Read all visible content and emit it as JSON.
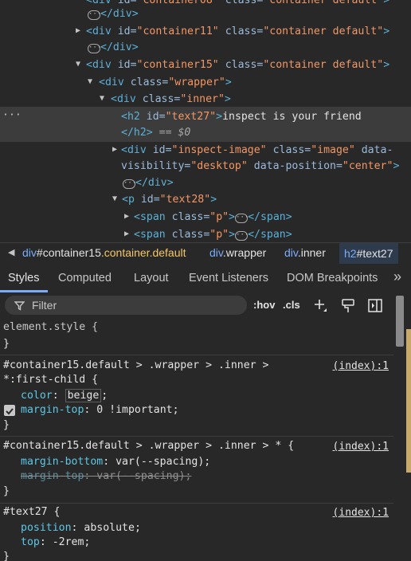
{
  "dom": {
    "top_partial": "<div id=\"container08\" class=\"container default\">",
    "l1_close": "</div>",
    "l2_open_tag": "<div",
    "l2_id_name": " id=",
    "l2_id_val": "\"container11\"",
    "l2_class_name": " class=",
    "l2_class_val": "\"container default\"",
    "l2_end": ">",
    "l3_close": "</div>",
    "l4_id_val": "\"container15\"",
    "l4_class_val": "\"container default\"",
    "l5_tag": "<div",
    "l5_class_val": "\"wrapper\"",
    "l6_class_val": "\"inner\"",
    "l7_tag": "<h2",
    "l7_id_val": "\"text27\"",
    "l7_text": "inspect is your friend",
    "l8_close": "</h2>",
    "l8_eq": " == ",
    "l8_var": "$0",
    "l9_id_val": "\"inspect-image\"",
    "l9_class_val": "\"image\"",
    "l9_data": " data-",
    "l10_attr1": "visibility=",
    "l10_val1": "\"desktop\"",
    "l10_attr2": " data-position=",
    "l10_val2": "\"center\"",
    "l10_end": ">",
    "l11_close": "</div>",
    "l12_tag": "<p",
    "l12_id_val": "\"text28\"",
    "l13_tag": "<span",
    "l13_class_val": "\"p\"",
    "l13_close": "</span>",
    "l14_tag": "<span",
    "l14_class_val": "\"p\"",
    "l14_close": "</span>",
    "ellipsis": "···",
    "row_dots": "···",
    "div_tag": "<div",
    "id_name": " id=",
    "class_name": " class=",
    "gt": ">"
  },
  "breadcrumb": {
    "c1_tag": "div",
    "c1_id": "#container15",
    "c1_cls": ".container.default",
    "c2_tag": "div",
    "c2_cls": ".wrapper",
    "c3_tag": "div",
    "c3_cls": ".inner",
    "c4_tag": "h2",
    "c4_id": "#text27"
  },
  "tabs": {
    "styles": "Styles",
    "computed": "Computed",
    "layout": "Layout",
    "event_listeners": "Event Listeners",
    "dom_breakpoints": "DOM Breakpoints",
    "more": "»"
  },
  "filter": {
    "placeholder": "Filter",
    "hov": ":hov",
    "cls": ".cls"
  },
  "styles": {
    "r1_selector": "element.style {",
    "r1_close": "}",
    "r2_selector_a": "#container15.default > .wrapper > .inner >",
    "r2_selector_b": "*:first-child {",
    "r2_link": "(index):1",
    "r2_p1_name": "color",
    "r2_p1_val": "beige",
    "r2_p2_name": "margin-top",
    "r2_p2_val": "0 !important",
    "r2_close": "}",
    "r3_selector": "#container15.default > .wrapper > .inner > * {",
    "r3_link": "(index):1",
    "r3_p1_name": "margin-bottom",
    "r3_p1_val": "var(--spacing)",
    "r3_p2_name": "margin-top",
    "r3_p2_val": "var(--spacing)",
    "r3_close": "}",
    "r4_selector": "#text27 {",
    "r4_link": "(index):1",
    "r4_p1_name": "position",
    "r4_p1_val": "absolute",
    "r4_p2_name": "top",
    "r4_p2_val": "-2rem",
    "r4_close": "}"
  },
  "colors": {
    "tag": "#5db0d7",
    "attr_value": "#f29766",
    "property": "#5cc8e6",
    "link": "#7cacf8",
    "class_highlight": "#f1c76b"
  }
}
